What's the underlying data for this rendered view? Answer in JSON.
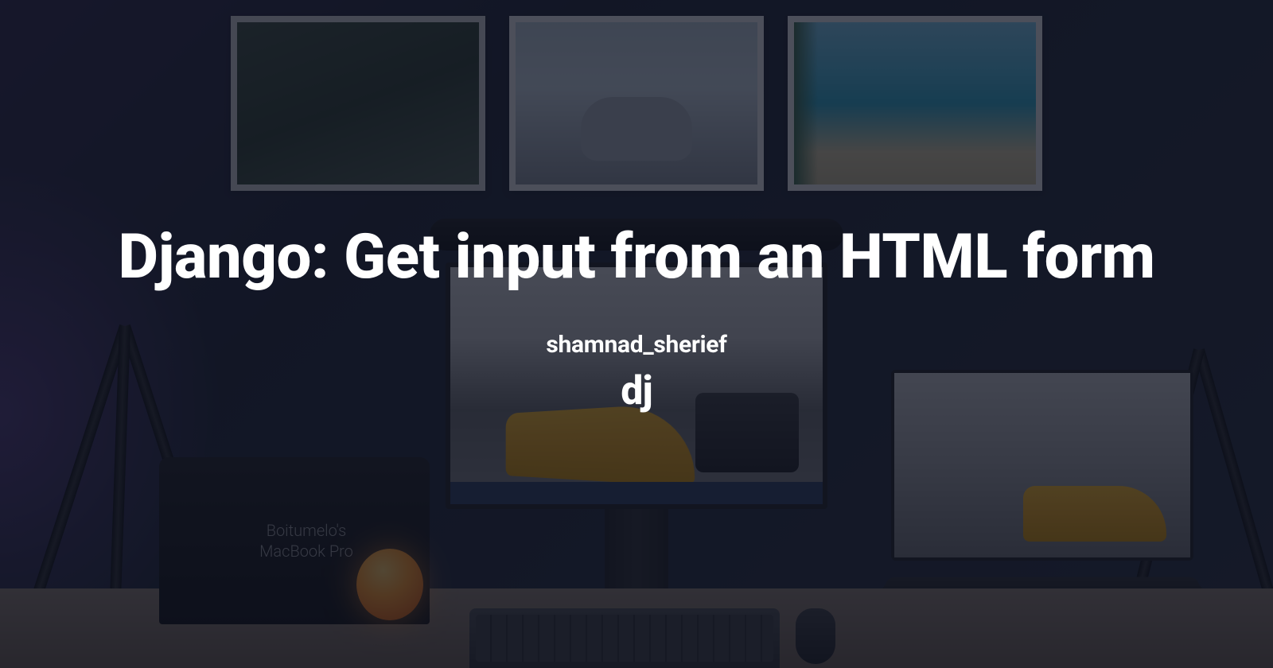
{
  "title": "Django: Get input from an HTML form",
  "author": "shamnad_sherief",
  "logo": "dj",
  "macbook": {
    "line1": "Boitumelo's",
    "line2": "MacBook Pro"
  }
}
